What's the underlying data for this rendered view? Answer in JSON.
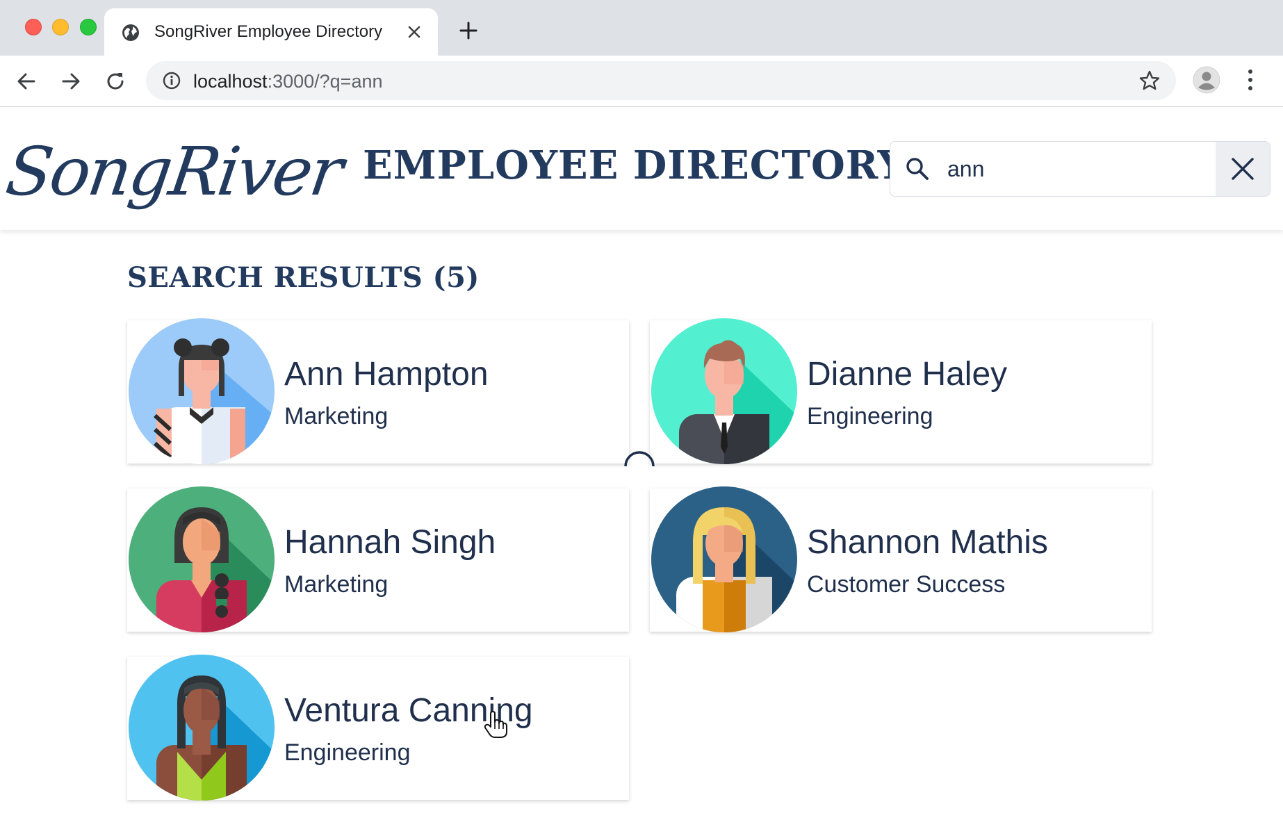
{
  "browser": {
    "tab_title": "SongRiver Employee Directory",
    "url_host": "localhost",
    "url_rest": ":3000/?q=ann"
  },
  "header": {
    "logo_text": "SongRiver",
    "title": "EMPLOYEE DIRECTORY",
    "search_value": "ann"
  },
  "results": {
    "heading": "SEARCH RESULTS (5)",
    "employees": [
      {
        "name": "Ann Hampton",
        "department": "Marketing"
      },
      {
        "name": "Dianne Haley",
        "department": "Engineering"
      },
      {
        "name": "Hannah Singh",
        "department": "Marketing"
      },
      {
        "name": "Shannon Mathis",
        "department": "Customer Success"
      },
      {
        "name": "Ventura Canning",
        "department": "Engineering"
      }
    ]
  },
  "colors": {
    "brand_navy": "#223a5e",
    "text": "#1f2f4c"
  },
  "icons": [
    "globe-icon",
    "close-icon",
    "plus-icon",
    "back-arrow-icon",
    "forward-arrow-icon",
    "reload-icon",
    "info-icon",
    "star-icon",
    "profile-icon",
    "kebab-menu-icon",
    "search-icon",
    "clear-icon",
    "loading-spinner-icon",
    "hand-cursor-icon"
  ]
}
